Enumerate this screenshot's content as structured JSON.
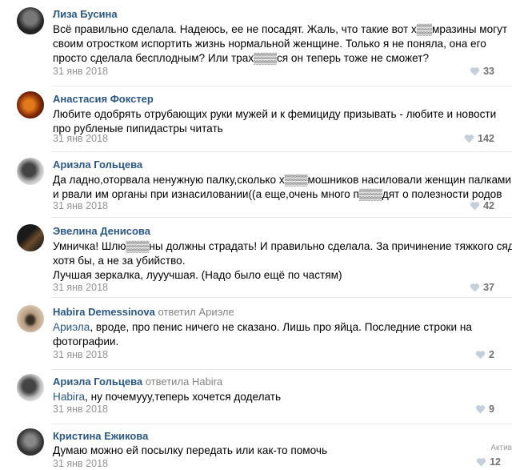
{
  "comments": [
    {
      "author": "Лиза Бусина",
      "lines": [
        "Всё правильно сделала. Надеюсь, ее не посадят. Жаль, что такие вот х▒▒мразины могут",
        "своим отростком испортить жизнь нормальной женщине. Только я не поняла, она его",
        "просто сделала бесплодным? Или трах▒▒▒ся он теперь тоже не сможет?"
      ],
      "date": "31 янв 2018",
      "likes": "33"
    },
    {
      "author": "Анастасия Фокстер",
      "lines": [
        "Любите одобрять отрубающих руки мужей и к фемициду призывать - любите и новости",
        "про рубленые пипидастры читать"
      ],
      "date": "31 янв 2018",
      "likes": "142"
    },
    {
      "author": "Ариэла Гольцева",
      "lines": [
        "Да ладно,оторвала ненужную палку,сколько х▒▒▒мошников насиловали женщин палками",
        "и рвали им органы при изнасиловании((а еще,очень много п▒▒▒дят о полезности родов"
      ],
      "date": "31 янв 2018",
      "likes": "42"
    },
    {
      "author": "Эвелина Денисова",
      "lines": [
        "Умничка! Шлю▒▒▒ны должны страдать! И правильно сделала. За причинение тяжкого сядет",
        "хотя бы, а не за убийство.",
        "Лучшая зеркалка, лууучшая. (Надо было ещё по частям)"
      ],
      "date": "31 янв 2018",
      "likes": "37"
    },
    {
      "author": "Habira Demessinova",
      "reply_word": "ответил",
      "reply_to": "Ариэле",
      "mention": "Ариэла",
      "lines": [
        ", вроде, про пенис ничего не сказано. Лишь про яйца. Последние строки на",
        "фотографии."
      ],
      "date": "31 янв 2018",
      "likes": "2"
    },
    {
      "author": "Ариэла Гольцева",
      "reply_word": "ответила",
      "reply_to": "Habira",
      "mention": "Habira",
      "lines": [
        ", ну почемууу,теперь хочется доделать"
      ],
      "date": "31 янв 2018",
      "likes": "9"
    },
    {
      "author": "Кристина Ежикова",
      "lines": [
        "Думаю можно ей посылку передать или как-то помочь"
      ],
      "date": "31 янв 2018",
      "likes": "12"
    }
  ],
  "watermark": "Актив",
  "colors": {
    "link": "#2a5885",
    "muted": "#939393",
    "separator": "#e7e8ec"
  },
  "icons": {
    "like": "heart-icon"
  }
}
